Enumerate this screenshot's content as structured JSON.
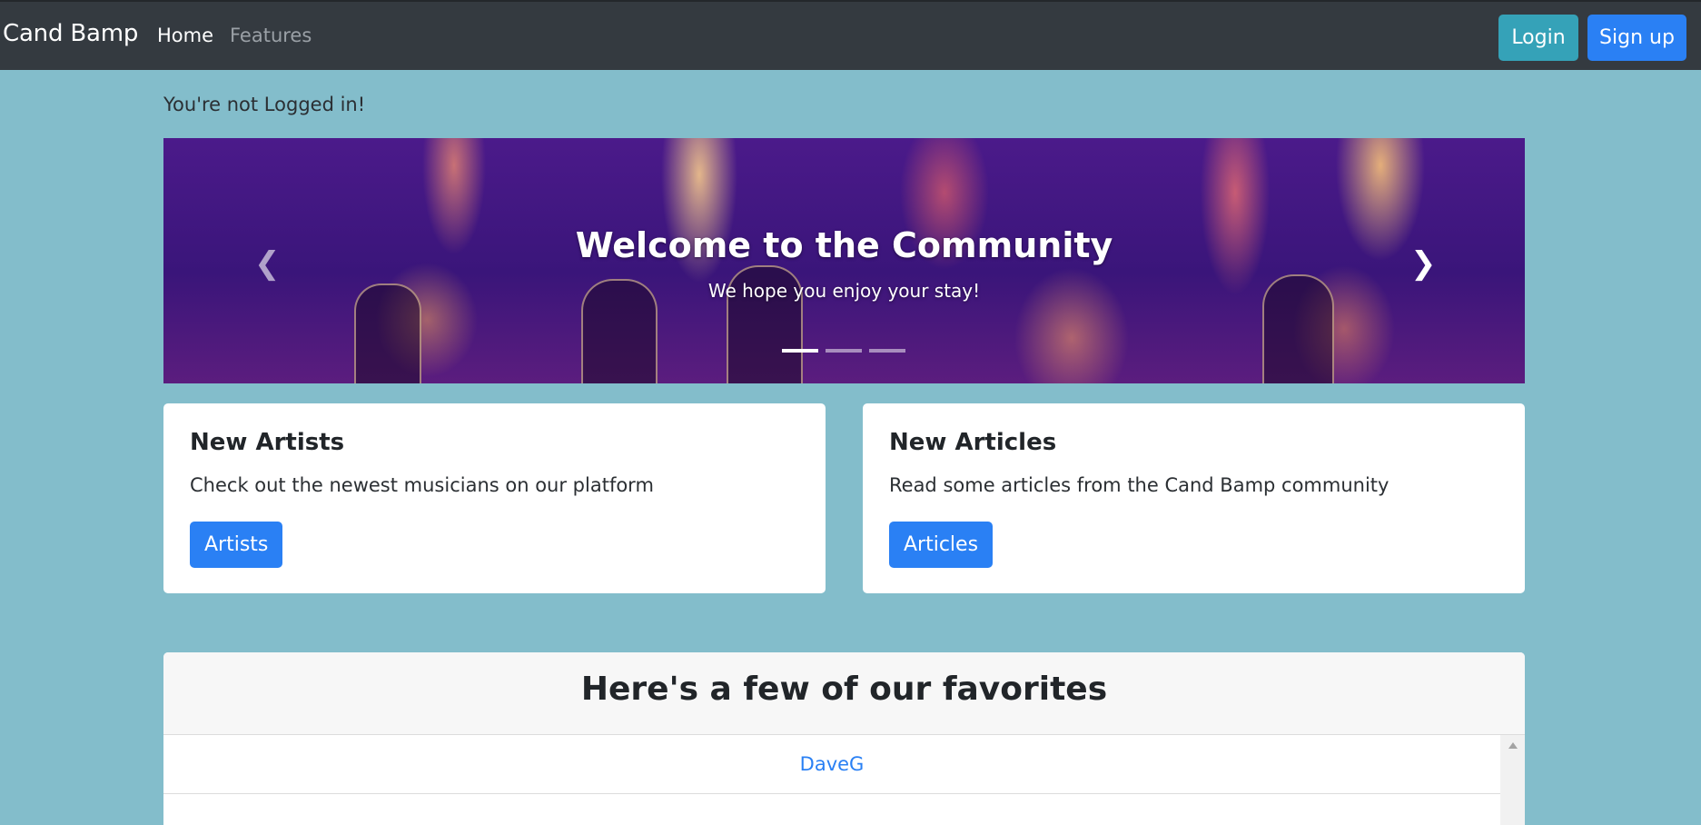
{
  "navbar": {
    "brand": "Cand Bamp",
    "links": [
      {
        "label": "Home"
      },
      {
        "label": "Features"
      }
    ],
    "login_label": "Login",
    "signup_label": "Sign up"
  },
  "status_text": "You're not Logged in!",
  "carousel": {
    "title": "Welcome to the Community",
    "subtitle": "We hope you enjoy your stay!",
    "prev_icon": "chevron-left",
    "next_icon": "chevron-right",
    "slides_count": 3,
    "active_slide": 1
  },
  "cards": [
    {
      "title": "New Artists",
      "text": "Check out the newest musicians on our platform",
      "button": "Artists"
    },
    {
      "title": "New Articles",
      "text": "Read some articles from the Cand Bamp community",
      "button": "Articles"
    }
  ],
  "favorites": {
    "title": "Here's a few of our favorites",
    "items": [
      "DaveG"
    ]
  },
  "colors": {
    "page_bg": "#83bdcb",
    "navbar_bg": "#343a40",
    "primary": "#2a80f4",
    "info": "#35a2b8"
  }
}
